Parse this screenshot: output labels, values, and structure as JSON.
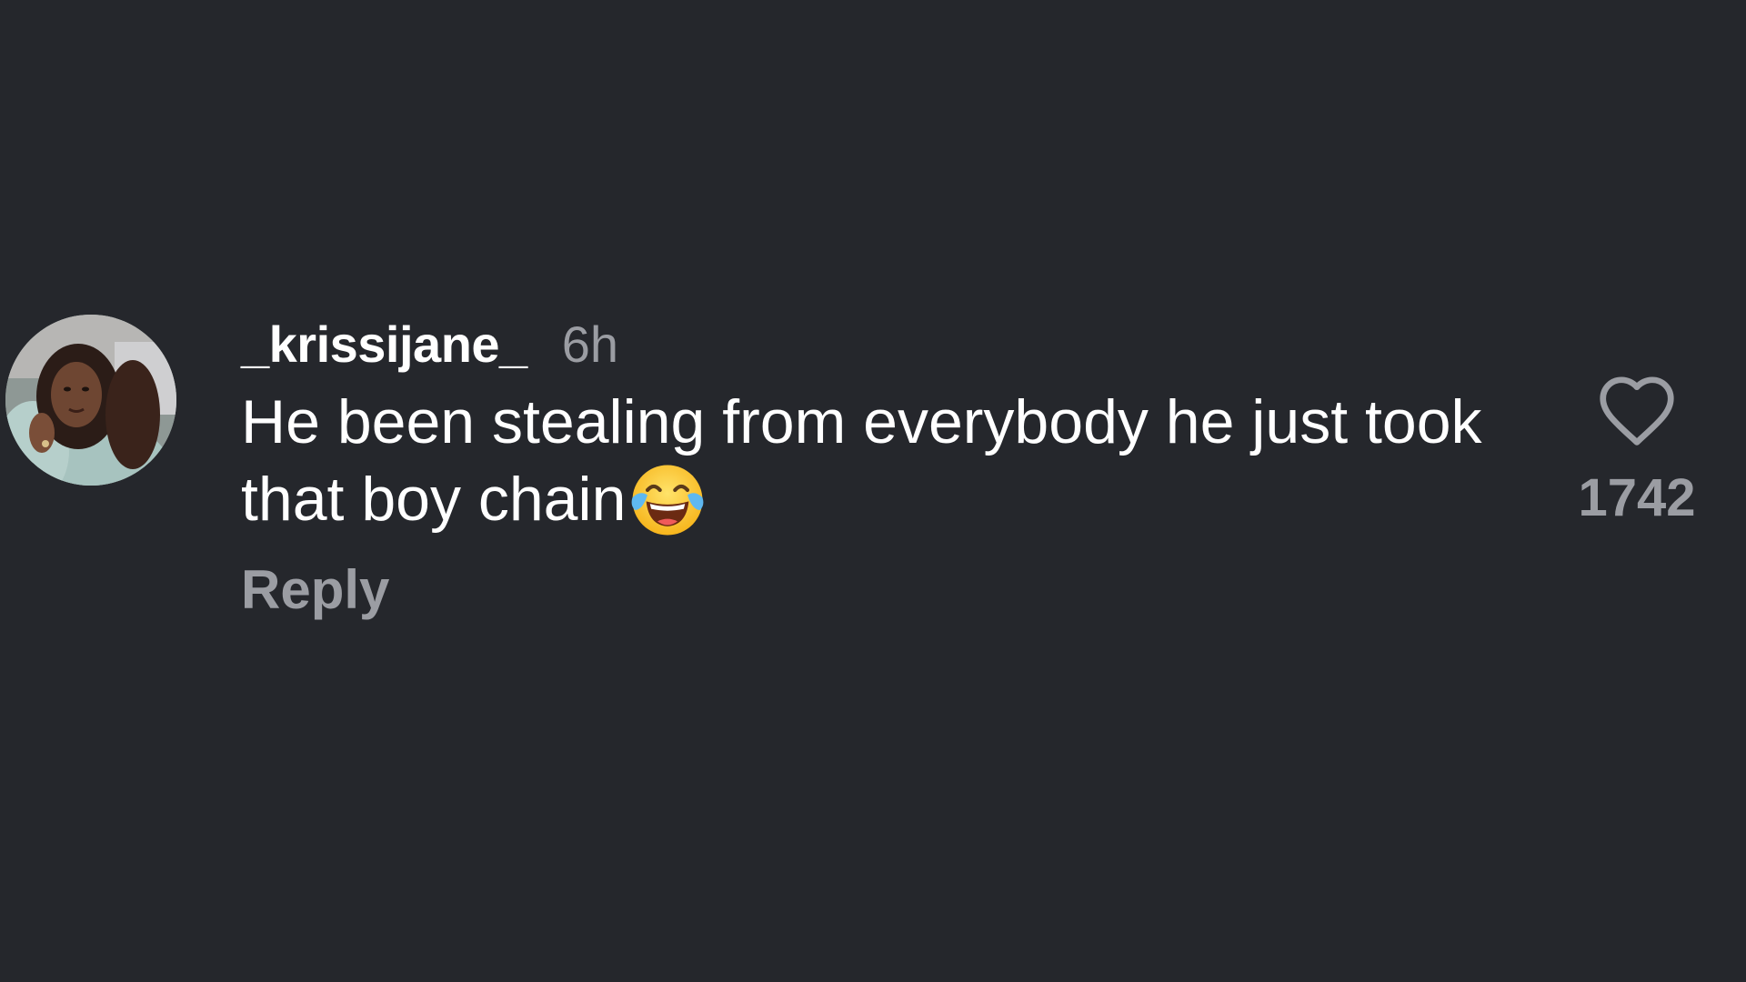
{
  "comment": {
    "username": "_krissijane_",
    "time": "6h",
    "text": "He been stealing from everybody he just took that boy chain",
    "emoji": "face-with-tears-of-joy",
    "reply_label": "Reply",
    "like_count": "1742"
  },
  "colors": {
    "background": "#25272c",
    "primary_text": "#ffffff",
    "secondary_text": "#9b9da3"
  },
  "icons": {
    "like": "heart-outline-icon"
  }
}
